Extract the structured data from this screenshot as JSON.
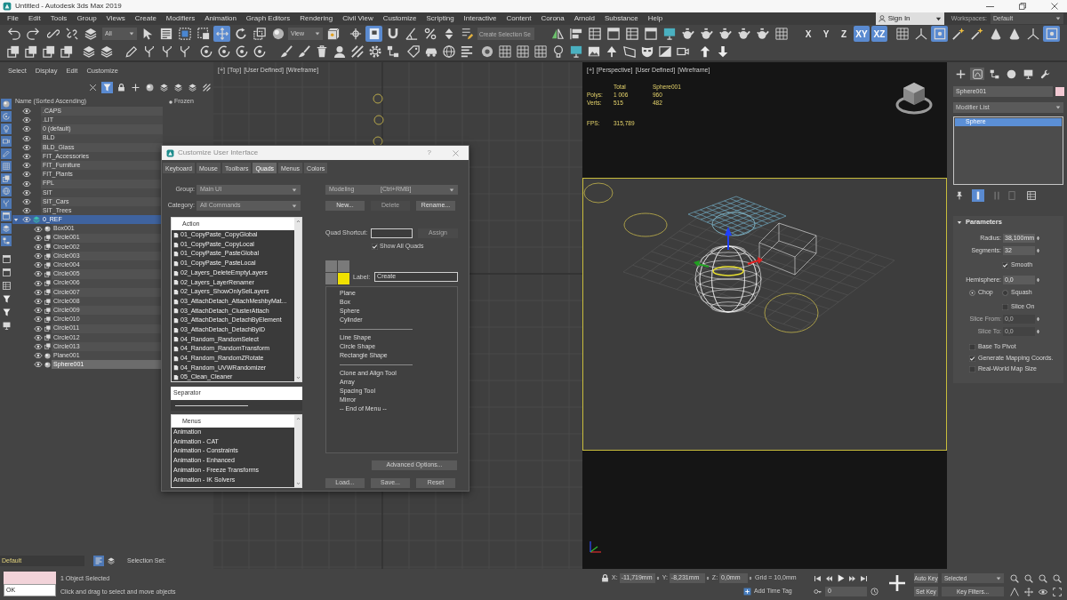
{
  "window": {
    "title": "Untitled - Autodesk 3ds Max 2019"
  },
  "menu_bar": {
    "items": [
      "File",
      "Edit",
      "Tools",
      "Group",
      "Views",
      "Create",
      "Modifiers",
      "Animation",
      "Graph Editors",
      "Rendering",
      "Civil View",
      "Customize",
      "Scripting",
      "Interactive",
      "Content",
      "Corona",
      "Arnold",
      "Substance",
      "Help"
    ],
    "sign_in": "Sign In",
    "workspaces_label": "Workspaces:",
    "workspace": "Default"
  },
  "main_toolbar": [
    {
      "kind": "icon",
      "selected": false
    },
    {
      "kind": "icon",
      "selected": false
    },
    {
      "kind": "icon",
      "selected": false
    },
    {
      "kind": "icon",
      "selected": false
    },
    {
      "kind": "icon",
      "selected": false
    },
    {
      "kind": "dropdown",
      "value": "All"
    },
    {
      "kind": "icon",
      "selected": false
    },
    {
      "kind": "icon",
      "selected": false
    },
    {
      "kind": "icon",
      "selected": false
    },
    {
      "kind": "icon",
      "selected": false
    },
    {
      "kind": "icon",
      "selected": true
    },
    {
      "kind": "icon",
      "selected": false
    },
    {
      "kind": "icon",
      "selected": false
    },
    {
      "kind": "icon",
      "selected": false
    },
    {
      "kind": "dropdown",
      "value": "View"
    },
    {
      "kind": "icon",
      "selected": false
    },
    {
      "kind": "icon",
      "selected": false
    },
    {
      "kind": "icon",
      "selected": true
    },
    {
      "kind": "icon",
      "selected": false
    },
    {
      "kind": "icon",
      "selected": false
    },
    {
      "kind": "icon",
      "selected": false
    },
    {
      "kind": "icon",
      "selected": false
    },
    {
      "kind": "icon",
      "selected": false
    },
    {
      "kind": "field",
      "placeholder": "Create Selection Se"
    },
    {
      "kind": "icon",
      "selected": false
    },
    {
      "kind": "icon",
      "selected": false
    },
    {
      "kind": "icon",
      "selected": false
    },
    {
      "kind": "icon",
      "selected": false
    },
    {
      "kind": "icon",
      "selected": false
    },
    {
      "kind": "icon",
      "selected": false
    },
    {
      "kind": "icon",
      "selected": false
    },
    {
      "kind": "icon",
      "selected": false
    },
    {
      "kind": "icon",
      "selected": false
    },
    {
      "kind": "icon",
      "selected": false
    },
    {
      "kind": "icon",
      "selected": false
    },
    {
      "kind": "icon",
      "selected": false
    },
    {
      "kind": "icon",
      "selected": false
    },
    {
      "kind": "toggle",
      "label": "X",
      "selected": false
    },
    {
      "kind": "toggle",
      "label": "Y",
      "selected": false
    },
    {
      "kind": "toggle",
      "label": "Z",
      "selected": false
    },
    {
      "kind": "toggle",
      "label": "XY",
      "selected": true
    },
    {
      "kind": "toggle",
      "label": "XZ",
      "selected": true
    },
    {
      "kind": "icon",
      "selected": false
    },
    {
      "kind": "icon",
      "selected": false
    },
    {
      "kind": "icon",
      "selected": true
    },
    {
      "kind": "icon",
      "selected": false
    },
    {
      "kind": "icon",
      "selected": false
    },
    {
      "kind": "icon",
      "selected": false
    },
    {
      "kind": "icon",
      "selected": false
    },
    {
      "kind": "icon",
      "selected": false
    },
    {
      "kind": "icon",
      "selected": true
    }
  ],
  "scene_explorer": {
    "menu": [
      "Select",
      "Display",
      "Edit",
      "Customize"
    ],
    "toolbar": [
      {
        "selected": false
      },
      {
        "selected": true
      },
      {
        "selected": false
      },
      {
        "selected": false
      },
      {
        "selected": false
      },
      {
        "selected": false
      },
      {
        "selected": false
      },
      {
        "selected": false
      },
      {
        "selected": false
      }
    ],
    "filters": [
      {
        "selected": true
      },
      {
        "selected": true
      },
      {
        "selected": true
      },
      {
        "selected": true
      },
      {
        "selected": true
      },
      {
        "selected": true
      },
      {
        "selected": true
      },
      {
        "selected": true
      },
      {
        "selected": true
      },
      {
        "selected": true
      },
      {
        "selected": true
      },
      {
        "selected": true
      },
      {
        "selected": false
      },
      {
        "selected": false
      },
      {
        "selected": false
      },
      {
        "selected": false
      },
      {
        "selected": false
      },
      {
        "selected": false
      }
    ],
    "columns": [
      "Name (Sorted Ascending)",
      "Frozen"
    ],
    "layers": [
      {
        "name": ".CAPS",
        "current": false,
        "selected": false,
        "expanded": false
      },
      {
        "name": ".LIT",
        "current": false,
        "selected": false,
        "expanded": false
      },
      {
        "name": "0 (default)",
        "current": false,
        "selected": false,
        "expanded": false
      },
      {
        "name": "BLD",
        "current": false,
        "selected": false,
        "expanded": false
      },
      {
        "name": "BLD_Glass",
        "current": false,
        "selected": false,
        "expanded": false
      },
      {
        "name": "FIT_Accessories",
        "current": false,
        "selected": false,
        "expanded": false
      },
      {
        "name": "FIT_Furniture",
        "current": false,
        "selected": false,
        "expanded": false
      },
      {
        "name": "FIT_Plants",
        "current": false,
        "selected": false,
        "expanded": false
      },
      {
        "name": "FPL",
        "current": false,
        "selected": false,
        "expanded": false
      },
      {
        "name": "SIT",
        "current": false,
        "selected": false,
        "expanded": false
      },
      {
        "name": "SIT_Cars",
        "current": false,
        "selected": false,
        "expanded": false
      },
      {
        "name": "SIT_Trees",
        "current": false,
        "selected": false,
        "expanded": false
      },
      {
        "name": "0_REF",
        "current": true,
        "selected": true,
        "expanded": true,
        "children": [
          {
            "name": "Box001",
            "kind": "geometry",
            "selected": false
          },
          {
            "name": "Circle001",
            "kind": "shape",
            "selected": false
          },
          {
            "name": "Circle002",
            "kind": "shape",
            "selected": false
          },
          {
            "name": "Circle003",
            "kind": "shape",
            "selected": false
          },
          {
            "name": "Circle004",
            "kind": "shape",
            "selected": false
          },
          {
            "name": "Circle005",
            "kind": "shape",
            "selected": false
          },
          {
            "name": "Circle006",
            "kind": "shape",
            "selected": false
          },
          {
            "name": "Circle007",
            "kind": "shape",
            "selected": false
          },
          {
            "name": "Circle008",
            "kind": "shape",
            "selected": false
          },
          {
            "name": "Circle009",
            "kind": "shape",
            "selected": false
          },
          {
            "name": "Circle010",
            "kind": "shape",
            "selected": false
          },
          {
            "name": "Circle011",
            "kind": "shape",
            "selected": false
          },
          {
            "name": "Circle012",
            "kind": "shape",
            "selected": false
          },
          {
            "name": "Circle013",
            "kind": "shape",
            "selected": false
          },
          {
            "name": "Plane001",
            "kind": "geometry",
            "selected": false
          },
          {
            "name": "Sphere001",
            "kind": "geometry",
            "selected": true
          }
        ]
      }
    ],
    "footer": {
      "layer": "Default",
      "buttons": [
        {
          "selected": true
        },
        {
          "selected": false
        }
      ],
      "selection_set_label": "Selection Set:"
    }
  },
  "top_viewport": {
    "label": [
      "[+]",
      "[Top]",
      "[User Defined]",
      "[Wireframe]"
    ]
  },
  "perspective_viewport": {
    "label": [
      "[+]",
      "[Perspective]",
      "[User Defined]",
      "[Wireframe]"
    ],
    "stats": {
      "header": [
        "Total",
        "Sphere001"
      ],
      "rows": [
        {
          "label": "Polys:",
          "values": [
            "1 006",
            "960"
          ]
        },
        {
          "label": "Verts:",
          "values": [
            "515",
            "482"
          ]
        }
      ],
      "fps": {
        "label": "FPS:",
        "value": "315,789"
      }
    }
  },
  "customize_dialog": {
    "title": "Customize User Interface",
    "help": "?",
    "tabs": [
      {
        "label": "Keyboard",
        "selected": false
      },
      {
        "label": "Mouse",
        "selected": false
      },
      {
        "label": "Toolbars",
        "selected": false
      },
      {
        "label": "Quads",
        "selected": true
      },
      {
        "label": "Menus",
        "selected": false
      },
      {
        "label": "Colors",
        "selected": false
      }
    ],
    "group_label": "Group:",
    "group": "Main UI",
    "category_label": "Category:",
    "category": "All Commands",
    "actions": {
      "header": "Action",
      "items": [
        "01_CopyPaste_CopyGlobal",
        "01_CopyPaste_CopyLocal",
        "01_CopyPaste_PasteGlobal",
        "01_CopyPaste_PasteLocal",
        "02_Layers_DeleteEmptyLayers",
        "02_Layers_LayerRenamer",
        "02_Layers_ShowOnlySelLayers",
        "03_AttachDetach_AttachMeshbyMat...",
        "03_AttachDetach_ClusterAttach",
        "03_AttachDetach_DetachByElement",
        "03_AttachDetach_DetachByID",
        "04_Random_RandomSelect",
        "04_Random_RandomTransform",
        "04_Random_RandomZRotate",
        "04_Random_UVWRandomizer",
        "05_Clean_Cleaner"
      ]
    },
    "separator": "Separator",
    "menus": {
      "header": "Menus",
      "items": [
        "Animation",
        "Animation - CAT",
        "Animation - Constraints",
        "Animation - Enhanced",
        "Animation - Freeze Transforms",
        "Animation - IK Solvers"
      ]
    },
    "quad_set": {
      "name": "Modeling",
      "shortcut": "[Ctrl+RMB]"
    },
    "quad_buttons": [
      {
        "label": "New...",
        "disabled": false
      },
      {
        "label": "Delete",
        "disabled": true
      },
      {
        "label": "Rename...",
        "disabled": false
      }
    ],
    "quad_shortcut_label": "Quad Shortcut:",
    "assign": {
      "label": "Assign",
      "disabled": true
    },
    "show_all_quads": {
      "label": "Show All Quads",
      "checked": true
    },
    "quads": [
      {
        "selected": false
      },
      {
        "selected": false
      },
      {
        "selected": false
      },
      {
        "selected": true
      }
    ],
    "quad_label": {
      "label": "Label:",
      "value": "Create"
    },
    "quad_menu": [
      {
        "kind": "item",
        "label": "Plane"
      },
      {
        "kind": "item",
        "label": "Box"
      },
      {
        "kind": "item",
        "label": "Sphere"
      },
      {
        "kind": "item",
        "label": "Cylinder"
      },
      {
        "kind": "separator"
      },
      {
        "kind": "item",
        "label": "Line Shape"
      },
      {
        "kind": "item",
        "label": "Circle Shape"
      },
      {
        "kind": "item",
        "label": "Rectangle Shape"
      },
      {
        "kind": "separator"
      },
      {
        "kind": "item",
        "label": "Clone and Align Tool"
      },
      {
        "kind": "item",
        "label": "Array"
      },
      {
        "kind": "item",
        "label": "Spacing Tool"
      },
      {
        "kind": "item",
        "label": "Mirror"
      },
      {
        "kind": "item",
        "label": "-- End of Menu --"
      }
    ],
    "advanced": "Advanced Options...",
    "bottom_buttons": [
      "Load...",
      "Save...",
      "Reset"
    ]
  },
  "command_panel": {
    "tabs": [
      {
        "selected": false
      },
      {
        "selected": true
      },
      {
        "selected": false
      },
      {
        "selected": false
      },
      {
        "selected": false
      },
      {
        "selected": false
      }
    ],
    "object": {
      "name": "Sphere001",
      "color": "#f2c9d3"
    },
    "modifier_list": "Modifier List",
    "stack": [
      {
        "label": "Sphere",
        "selected": true
      }
    ],
    "stack_tools": [
      {
        "selected": false,
        "disabled": false
      },
      {
        "selected": true,
        "disabled": false
      },
      {
        "selected": false,
        "disabled": true
      },
      {
        "selected": false,
        "disabled": true
      },
      {
        "selected": false,
        "disabled": false
      }
    ],
    "rollout": {
      "title": "Parameters",
      "expanded": true,
      "params": [
        {
          "kind": "spinner",
          "label": "Radius:",
          "value": "38,100mm",
          "disabled": false
        },
        {
          "kind": "spinner",
          "label": "Segments:",
          "value": "32",
          "disabled": false
        },
        {
          "kind": "checkbox",
          "label": "Smooth",
          "checked": true,
          "disabled": false
        },
        {
          "kind": "spinner",
          "label": "Hemisphere:",
          "value": "0,0",
          "disabled": false
        },
        {
          "kind": "radio",
          "options": [
            {
              "label": "Chop",
              "selected": true
            },
            {
              "label": "Squash",
              "selected": false
            }
          ],
          "disabled": false
        },
        {
          "kind": "checkbox",
          "label": "Slice On",
          "checked": false,
          "disabled": false
        },
        {
          "kind": "spinner",
          "label": "Slice From:",
          "value": "0,0",
          "disabled": true
        },
        {
          "kind": "spinner",
          "label": "Slice To:",
          "value": "0,0",
          "disabled": true
        },
        {
          "kind": "checkbox",
          "label": "Base To Pivot",
          "checked": false,
          "disabled": false
        },
        {
          "kind": "checkbox",
          "label": "Generate Mapping Coords.",
          "checked": true,
          "disabled": false
        },
        {
          "kind": "checkbox",
          "label": "Real-World Map Size",
          "checked": false,
          "disabled": false
        }
      ]
    }
  },
  "status_bar": {
    "listener_output": "OK",
    "selection_info": "1 Object Selected",
    "prompt": "Click and drag to select and move objects",
    "coords": [
      {
        "label": "X:",
        "value": "-11,719mm"
      },
      {
        "label": "Y:",
        "value": "-8,231mm"
      },
      {
        "label": "Z:",
        "value": "0,0mm"
      }
    ],
    "grid": "Grid = 10,0mm",
    "time_tag": "Add Time Tag",
    "frame": "0",
    "auto_key": "Auto Key",
    "key_mode": "Selected",
    "set_key": "Set Key",
    "key_filters": "Key Filters..."
  }
}
